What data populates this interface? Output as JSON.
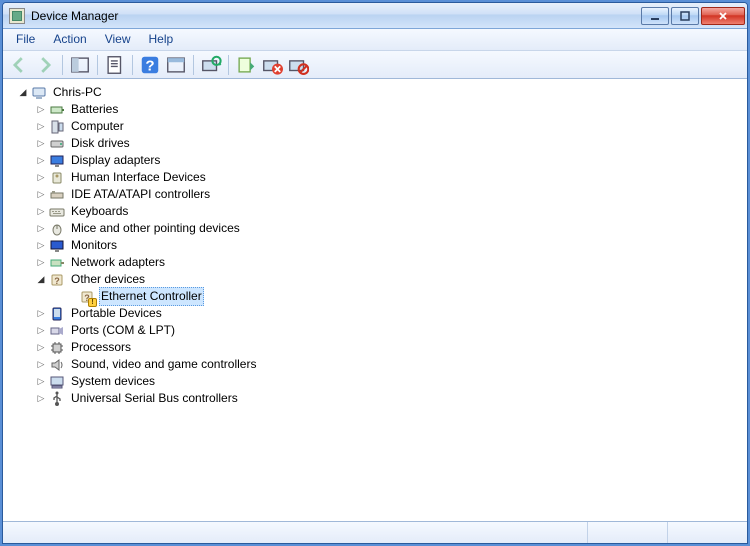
{
  "window": {
    "title": "Device Manager"
  },
  "menu": {
    "file": "File",
    "action": "Action",
    "view": "View",
    "help": "Help"
  },
  "tree": {
    "root": "Chris-PC",
    "categories": [
      "Batteries",
      "Computer",
      "Disk drives",
      "Display adapters",
      "Human Interface Devices",
      "IDE ATA/ATAPI controllers",
      "Keyboards",
      "Mice and other pointing devices",
      "Monitors",
      "Network adapters",
      "Other devices",
      "Portable Devices",
      "Ports (COM & LPT)",
      "Processors",
      "Sound, video and game controllers",
      "System devices",
      "Universal Serial Bus controllers"
    ],
    "other_devices_child": "Ethernet Controller"
  }
}
